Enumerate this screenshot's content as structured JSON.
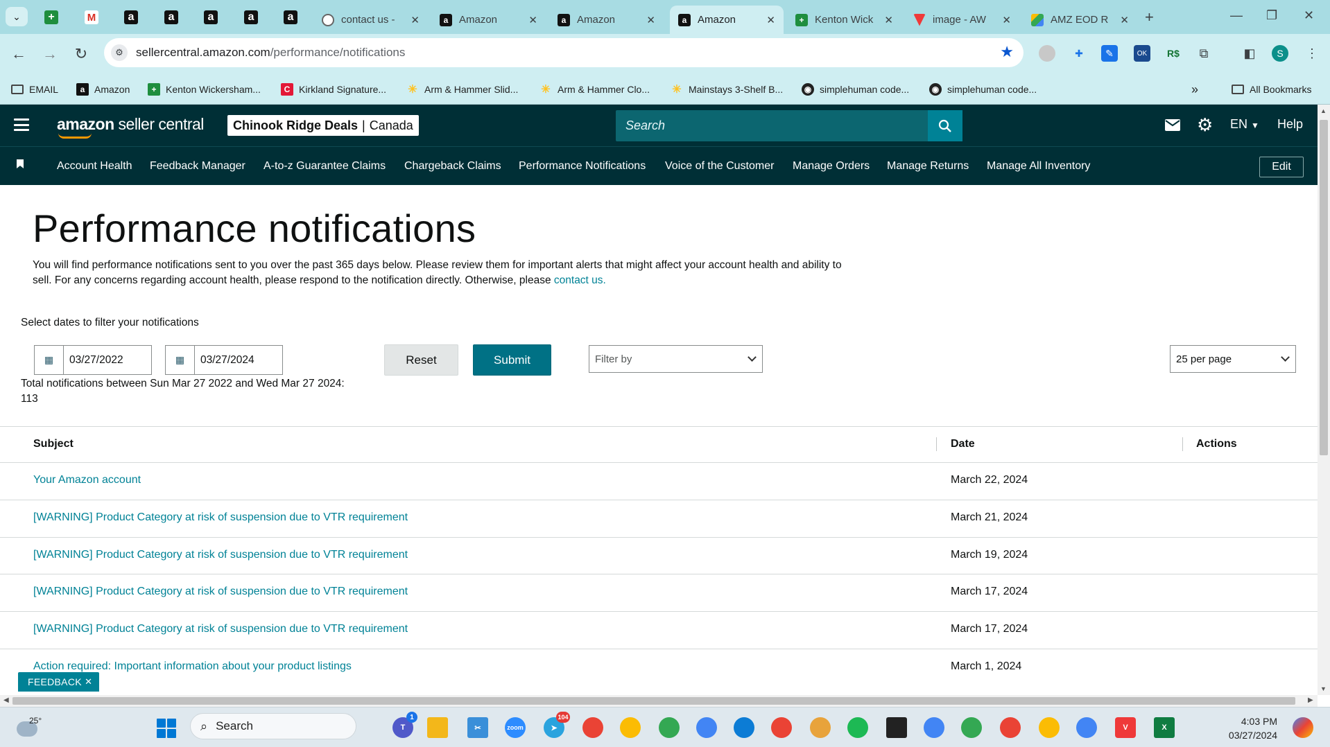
{
  "browser": {
    "tabs": [
      {
        "title": "contact us - ",
        "icon": "globe-icon"
      },
      {
        "title": "Amazon",
        "icon": "amazon-icon"
      },
      {
        "title": "Amazon",
        "icon": "amazon-icon"
      },
      {
        "title": "Amazon",
        "icon": "amazon-icon",
        "active": true
      },
      {
        "title": "Kenton Wick",
        "icon": "sheets-icon"
      },
      {
        "title": "image - AW",
        "icon": "vivaldi-icon"
      },
      {
        "title": "AMZ EOD R",
        "icon": "drive-icon"
      }
    ],
    "url_host": "sellercentral.amazon.com",
    "url_path": "/performance/notifications",
    "profile_initial": "S",
    "bookmarks": [
      {
        "label": "EMAIL",
        "icon": "folder-icon"
      },
      {
        "label": "Amazon",
        "icon": "amazon-icon"
      },
      {
        "label": "Kenton Wickersham...",
        "icon": "sheets-icon"
      },
      {
        "label": "Kirkland Signature...",
        "icon": "costco-icon"
      },
      {
        "label": "Arm & Hammer Slid...",
        "icon": "walmart-icon"
      },
      {
        "label": "Arm & Hammer Clo...",
        "icon": "walmart-icon"
      },
      {
        "label": "Mainstays 3-Shelf B...",
        "icon": "walmart-icon"
      },
      {
        "label": "simplehuman code...",
        "icon": "globe-icon"
      },
      {
        "label": "simplehuman code...",
        "icon": "globe-icon"
      }
    ],
    "all_bookmarks": "All Bookmarks"
  },
  "header": {
    "logo_prefix": "amazon",
    "logo_suffix": "seller central",
    "store_name": "Chinook Ridge Deals",
    "store_region": "Canada",
    "search_placeholder": "Search",
    "language": "EN",
    "help": "Help"
  },
  "nav": {
    "links": [
      "Account Health",
      "Feedback Manager",
      "A-to-z Guarantee Claims",
      "Chargeback Claims",
      "Performance Notifications",
      "Voice of the Customer",
      "Manage Orders",
      "Manage Returns",
      "Manage All Inventory"
    ],
    "edit": "Edit"
  },
  "page": {
    "title": "Performance notifications",
    "description": "You will find performance notifications sent to you over the past 365 days below. Please review them for important alerts that might affect your account health and ability to sell. For any concerns regarding account health, please respond to the notification directly. Otherwise, please",
    "contact_link": "contact us.",
    "filter_label": "Select dates to filter your notifications",
    "start_date": "03/27/2022",
    "end_date": "03/27/2024",
    "reset": "Reset",
    "submit": "Submit",
    "filter_by_placeholder": "Filter by",
    "per_page": "25 per page",
    "total_text": "Total notifications between Sun Mar 27 2022 and Wed Mar 27 2024:",
    "total_count": "113"
  },
  "table": {
    "headers": {
      "subject": "Subject",
      "date": "Date",
      "actions": "Actions"
    },
    "rows": [
      {
        "subject": "Your Amazon account",
        "date": "March 22, 2024"
      },
      {
        "subject": "[WARNING] Product Category at risk of suspension due to VTR requirement",
        "date": "March 21, 2024"
      },
      {
        "subject": "[WARNING] Product Category at risk of suspension due to VTR requirement",
        "date": "March 19, 2024"
      },
      {
        "subject": "[WARNING] Product Category at risk of suspension due to VTR requirement",
        "date": "March 17, 2024"
      },
      {
        "subject": "[WARNING] Product Category at risk of suspension due to VTR requirement",
        "date": "March 17, 2024"
      },
      {
        "subject": "Action required: Important information about your product listings",
        "date": "March 1, 2024"
      }
    ]
  },
  "feedback": "FEEDBACK",
  "taskbar": {
    "temperature": "25°",
    "search": "Search",
    "time": "4:03 PM",
    "date": "03/27/2024",
    "teams_badge": "1",
    "telegram_badge": "104"
  },
  "colors": {
    "tab_strip": "#a8dce3",
    "toolbar": "#cfeef2",
    "sc_header": "#002f36",
    "link": "#008296",
    "submit": "#007185"
  }
}
